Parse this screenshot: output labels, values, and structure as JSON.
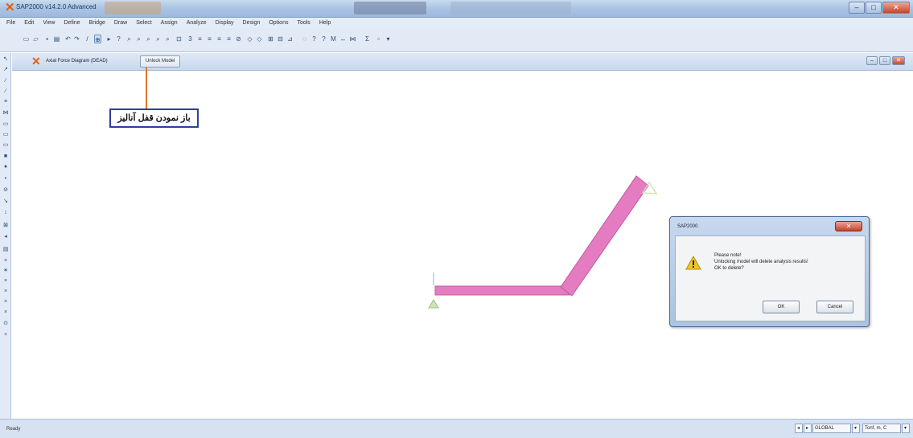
{
  "app": {
    "title": "SAP2000 v14.2.0 Advanced",
    "accent_color": "#e25f12"
  },
  "menu": [
    "File",
    "Edit",
    "View",
    "Define",
    "Bridge",
    "Draw",
    "Select",
    "Assign",
    "Analyze",
    "Display",
    "Design",
    "Options",
    "Tools",
    "Help"
  ],
  "window_controls": {
    "minimize": "–",
    "maximize": "□",
    "close": "✕"
  },
  "inner_window": {
    "title": "Axial Force Diagram  (DEAD)",
    "unlock_button": "Unlock Model"
  },
  "annotation": {
    "text": "باز نمودن قفل آنالیز",
    "line_color": "#e8751f",
    "box_color": "#2f3f9a"
  },
  "model": {
    "member_color": "#e57bc1"
  },
  "dialog": {
    "title": "SAP2000",
    "close_label": "✕",
    "message": [
      "Please note!",
      "Unlocking model will delete analysis results!",
      "OK to delete?"
    ],
    "ok_label": "OK",
    "cancel_label": "Cancel",
    "icon": "warning-icon"
  },
  "status": {
    "text": "Ready",
    "coord_system": "GLOBAL",
    "units": "Tonf, m, C"
  }
}
